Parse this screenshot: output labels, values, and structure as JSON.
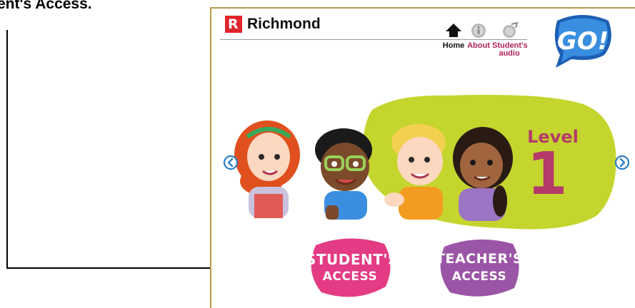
{
  "annotation": {
    "caption": "ent's Access."
  },
  "header": {
    "brand": "Richmond",
    "brand_letter": "R",
    "nav": [
      {
        "label": "Home",
        "icon": "home-icon",
        "color": "#111111"
      },
      {
        "label": "About",
        "icon": "info-icon",
        "color": "#b0235a"
      },
      {
        "label": "Student's audio",
        "icon": "audio-icon",
        "color": "#b0235a"
      }
    ],
    "logo_text": "GO!"
  },
  "banner": {
    "level_label": "Level",
    "level_number": "1",
    "level_color": "#b43a6a",
    "blob_color": "#c4d52d",
    "prev_icon": "chevron-left-icon",
    "next_icon": "chevron-right-icon"
  },
  "access": {
    "student": {
      "line1": "STUDENT'S",
      "line2": "ACCESS",
      "color": "#e33b84"
    },
    "teacher": {
      "line1": "TEACHER'S",
      "line2": "ACCESS",
      "color": "#9b55a6"
    }
  }
}
